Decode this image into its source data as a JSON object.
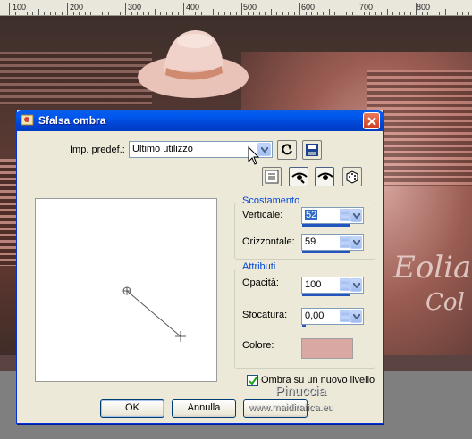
{
  "ruler": {
    "labels": [
      "100",
      "200",
      "300",
      "400",
      "500",
      "600",
      "700",
      "800"
    ]
  },
  "background": {
    "signature_line1": "Eolia",
    "signature_line2": "Col"
  },
  "dialog": {
    "title": "Sfalsa ombra",
    "preset_label": "Imp. predef.:",
    "preset_value": "Ultimo utilizzo",
    "offset_group": {
      "title": "Scostamento",
      "vertical_label": "Verticale:",
      "vertical_value": "52",
      "horizontal_label": "Orizzontale:",
      "horizontal_value": "59"
    },
    "attributes_group": {
      "title": "Attributi",
      "opacity_label": "Opacità:",
      "opacity_value": "100",
      "blur_label": "Sfocatura:",
      "blur_value": "0,00",
      "color_label": "Colore:",
      "color_value": "#d9a8a2"
    },
    "new_layer_checkbox": {
      "label": "Ombra su un nuovo livello",
      "checked": true
    },
    "buttons": {
      "ok": "OK",
      "cancel": "Annulla"
    }
  },
  "watermark": {
    "line1": "Pinuccia",
    "line2": "www.maidirafica.eu"
  }
}
